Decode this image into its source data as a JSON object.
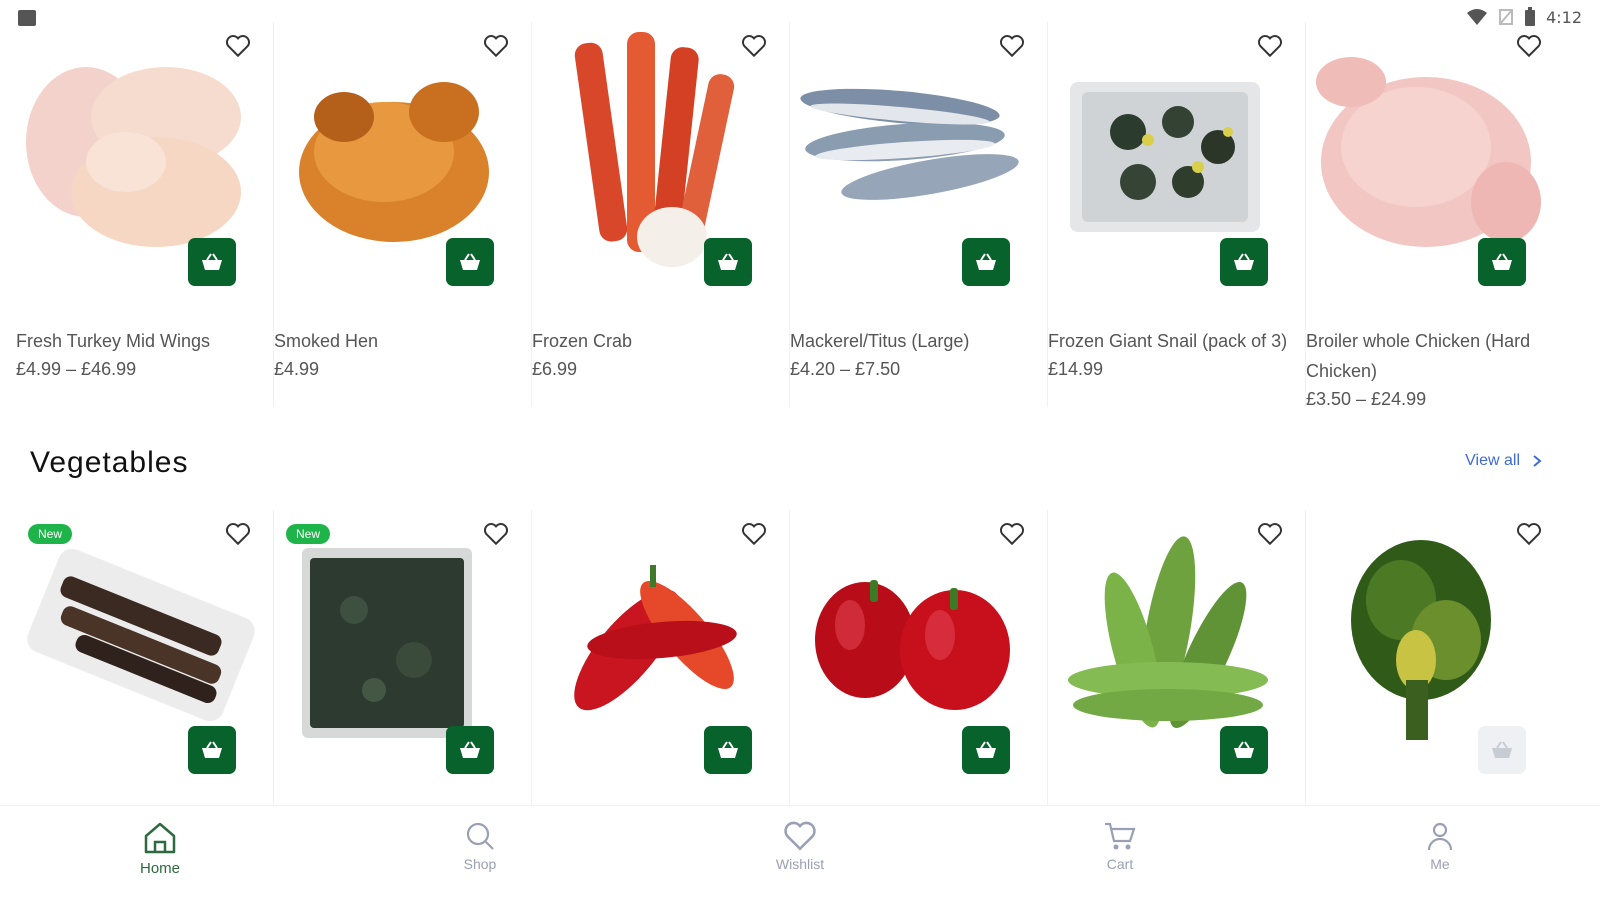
{
  "status_bar": {
    "time": "4:12"
  },
  "top_products": [
    {
      "name": "Fresh Turkey Mid Wings",
      "price": "£4.99 – £46.99",
      "image": "turkey-wings"
    },
    {
      "name": "Smoked Hen",
      "price": "£4.99",
      "image": "smoked-hen"
    },
    {
      "name": "Frozen Crab",
      "price": "£6.99",
      "image": "crab"
    },
    {
      "name": "Mackerel/Titus (Large)",
      "price": "£4.20 – £7.50",
      "image": "mackerel"
    },
    {
      "name": "Frozen Giant Snail (pack of 3)",
      "price": "£14.99",
      "image": "snail"
    },
    {
      "name": "Broiler whole Chicken (Hard Chicken)",
      "price": "£3.50 – £24.99",
      "image": "chicken"
    }
  ],
  "vegetables": {
    "title": "Vegetables",
    "view_all": "View all",
    "badge": "New",
    "products": [
      {
        "image": "dried-bark",
        "is_new": true
      },
      {
        "image": "frozen-leaves",
        "is_new": true
      },
      {
        "image": "red-chili",
        "is_new": false
      },
      {
        "image": "red-pepper",
        "is_new": false
      },
      {
        "image": "okra",
        "is_new": false
      },
      {
        "image": "leafy-greens",
        "is_new": false
      }
    ]
  },
  "bottom_nav": {
    "home": "Home",
    "shop": "Shop",
    "wishlist": "Wishlist",
    "cart": "Cart",
    "me": "Me"
  },
  "colors": {
    "brand_green": "#07622b",
    "new_badge": "#1fb44a",
    "link_blue": "#3e6bd6",
    "nav_inactive": "#9aa0b4"
  }
}
